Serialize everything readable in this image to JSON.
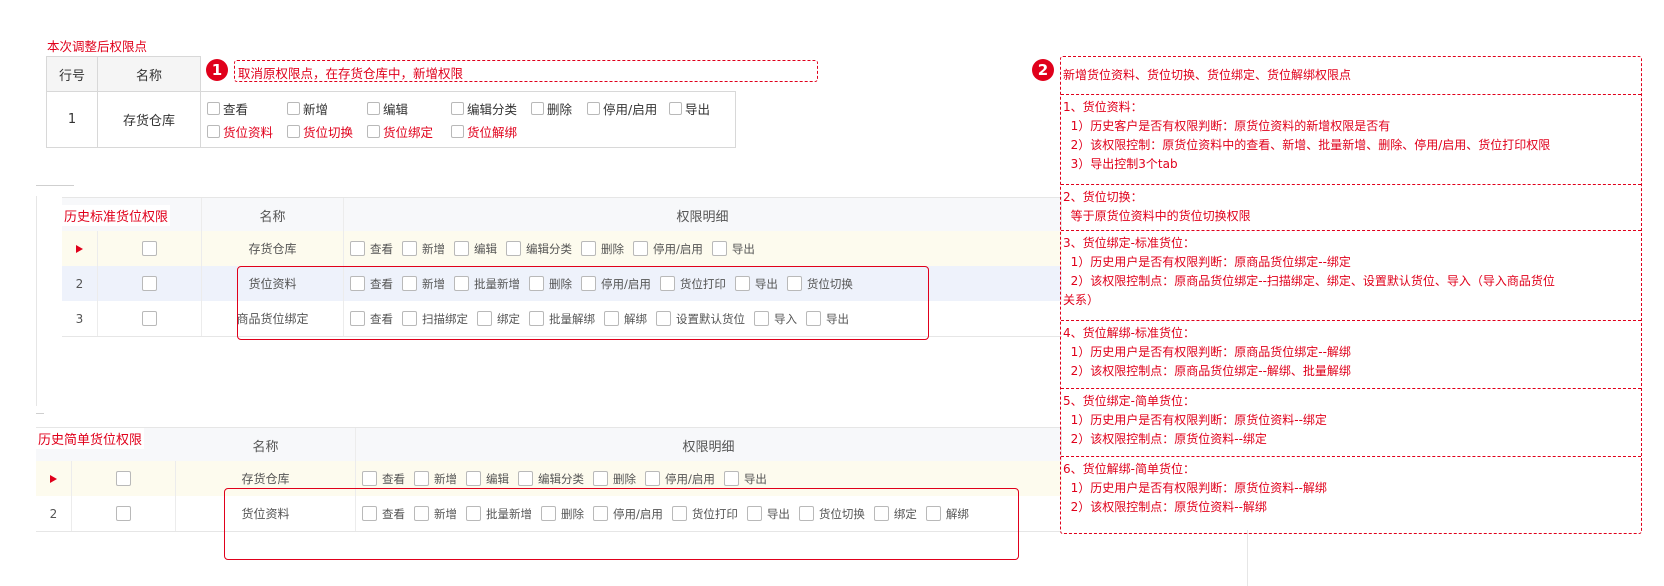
{
  "top": {
    "caption": "本次调整后权限点",
    "headers": {
      "row_no": "行号",
      "name": "名称"
    },
    "row": {
      "no": "1",
      "name": "存货仓库",
      "perms_line1": [
        "查看",
        "新增",
        "编辑",
        "编辑分类",
        "删除",
        "停用/启用",
        "导出"
      ],
      "perms_line2": [
        "货位资料",
        "货位切换",
        "货位绑定",
        "货位解绑"
      ]
    },
    "callout1": {
      "badge": "1",
      "text": "取消原权限点，在存货仓库中，新增权限"
    }
  },
  "grid1": {
    "label": "历史标准货位权限",
    "headers": {
      "name": "名称",
      "detail": "权限明细"
    },
    "rows": [
      {
        "no": "",
        "name": "存货仓库",
        "perms": [
          "查看",
          "新增",
          "编辑",
          "编辑分类",
          "删除",
          "停用/启用",
          "导出"
        ]
      },
      {
        "no": "2",
        "name": "货位资料",
        "perms": [
          "查看",
          "新增",
          "批量新增",
          "删除",
          "停用/启用",
          "货位打印",
          "导出",
          "货位切换"
        ]
      },
      {
        "no": "3",
        "name": "商品货位绑定",
        "perms": [
          "查看",
          "扫描绑定",
          "绑定",
          "批量解绑",
          "解绑",
          "设置默认货位",
          "导入",
          "导出"
        ]
      }
    ]
  },
  "grid2": {
    "label": "历史简单货位权限",
    "headers": {
      "name": "名称",
      "detail": "权限明细"
    },
    "rows": [
      {
        "no": "",
        "name": "存货仓库",
        "perms": [
          "查看",
          "新增",
          "编辑",
          "编辑分类",
          "删除",
          "停用/启用",
          "导出"
        ]
      },
      {
        "no": "2",
        "name": "货位资料",
        "perms": [
          "查看",
          "新增",
          "批量新增",
          "删除",
          "停用/启用",
          "货位打印",
          "导出",
          "货位切换",
          "绑定",
          "解绑"
        ]
      }
    ]
  },
  "notes": {
    "badge": "2",
    "title": "新增货位资料、货位切换、货位绑定、货位解绑权限点",
    "sections": [
      [
        "1、货位资料：",
        "  1）历史客户是否有权限判断：原货位资料的新增权限是否有",
        "  2）该权限控制：原货位资料中的查看、新增、批量新增、删除、停用/启用、货位打印权限",
        "  3）导出控制3个tab"
      ],
      [
        "2、货位切换：",
        "  等于原货位资料中的货位切换权限"
      ],
      [
        "3、货位绑定-标准货位：",
        "  1）历史用户是否有权限判断：原商品货位绑定--绑定",
        "  2）该权限控制点：原商品货位绑定--扫描绑定、绑定、设置默认货位、导入（导入商品货位",
        "关系）"
      ],
      [
        "4、货位解绑-标准货位：",
        "  1）历史用户是否有权限判断：原商品货位绑定--解绑",
        "  2）该权限控制点：原商品货位绑定--解绑、批量解绑"
      ],
      [
        "5、货位绑定-简单货位：",
        "  1）历史用户是否有权限判断：原货位资料--绑定",
        "  2）该权限控制点：原货位资料--绑定"
      ],
      [
        "6、货位解绑-简单货位：",
        "  1）历史用户是否有权限判断：原货位资料--解绑",
        "  2）该权限控制点：原货位资料--解绑"
      ]
    ]
  },
  "colors": {
    "accent_red": "#e0001b",
    "row_highlight": "#fdfbee",
    "row_selected": "#eef2fb"
  }
}
